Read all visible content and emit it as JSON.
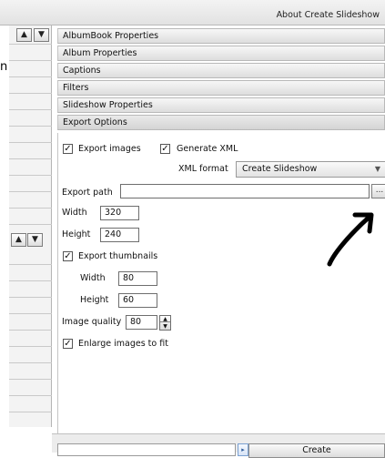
{
  "window": {
    "title": "About Create Slideshow"
  },
  "left_margin": {
    "partial_char": "n"
  },
  "left_panel": {
    "up_arrow": "▲",
    "down_arrow": "▼"
  },
  "sections": [
    {
      "label": "AlbumBook Properties"
    },
    {
      "label": "Album Properties"
    },
    {
      "label": "Captions"
    },
    {
      "label": "Filters"
    },
    {
      "label": "Slideshow Properties"
    },
    {
      "label": "Export Options"
    }
  ],
  "export": {
    "export_images": {
      "label": "Export images",
      "checked": true
    },
    "generate_xml": {
      "label": "Generate XML",
      "checked": true
    },
    "xml_format": {
      "label": "XML format",
      "value": "Create Slideshow"
    },
    "export_path": {
      "label": "Export path",
      "value": "",
      "browse_label": "..."
    },
    "width": {
      "label": "Width",
      "value": "320"
    },
    "height": {
      "label": "Height",
      "value": "240"
    },
    "export_thumbnails": {
      "label": "Export thumbnails",
      "checked": true
    },
    "thumb_width": {
      "label": "Width",
      "value": "80"
    },
    "thumb_height": {
      "label": "Height",
      "value": "60"
    },
    "image_quality": {
      "label": "Image quality",
      "value": "80"
    },
    "enlarge_images": {
      "label": "Enlarge images to fit",
      "checked": true
    }
  },
  "check_glyph": "✓",
  "bottom": {
    "create_label": "Create",
    "arrow_glyph": "▸"
  }
}
